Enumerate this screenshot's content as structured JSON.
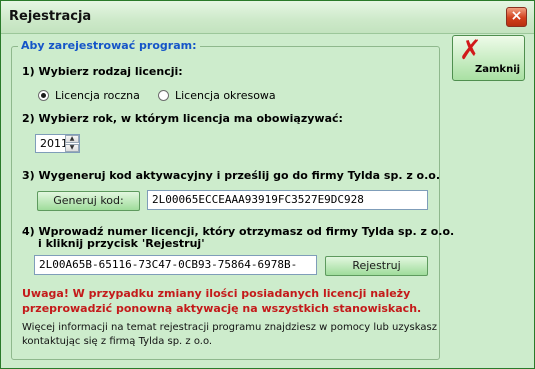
{
  "window": {
    "title": "Rejestracja",
    "close_glyph": "×"
  },
  "group": {
    "legend": "Aby zarejestrować program:"
  },
  "step1": {
    "label": "1)  Wybierz rodzaj licencji:",
    "options": [
      "Licencja roczna",
      "Licencja okresowa"
    ],
    "selected": "Licencja roczna"
  },
  "step2": {
    "label": "2)  Wybierz rok, w którym licencja ma obowiązywać:",
    "year": "2011"
  },
  "step3": {
    "label": "3)  Wygeneruj kod aktywacyjny i prześlij go do firmy Tylda sp. z o.o.",
    "button": "Generuj kod:",
    "code": "2L00065ECCEAAA93919FC3527E9DC928"
  },
  "step4": {
    "label_line1": "4)  Wprowadź numer licencji, który otrzymasz od firmy Tylda sp. z o.o.",
    "label_line2": "i kliknij przycisk 'Rejestruj'",
    "license": "2L00A65B-65116-73C47-0CB93-75864-6978B-",
    "button": "Rejestruj"
  },
  "warning": {
    "line1": "Uwaga! W przypadku zmiany ilości posiadanych licencji należy",
    "line2": "przeprowadzić ponowną aktywację na wszystkich stanowiskach."
  },
  "info": {
    "line1": "Więcej informacji na temat rejestracji programu znajdziesz w pomocy lub uzyskasz",
    "line2": "kontaktując się z firmą Tylda sp. z o.o."
  },
  "close_button": {
    "label": "Zamknij",
    "icon": "red-x-icon",
    "icon_color": "#d11a1a"
  },
  "colors": {
    "legend": "#1555c8",
    "warning": "#c41a1a",
    "background": "#cdeccc"
  }
}
